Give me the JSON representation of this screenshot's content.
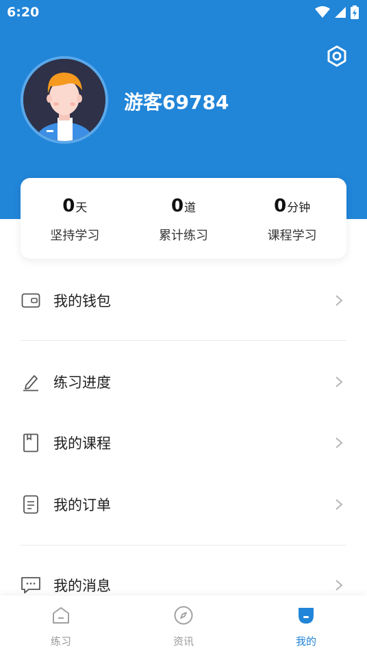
{
  "status_bar": {
    "time": "6:20",
    "icons": [
      "wifi-icon",
      "signal-icon",
      "battery-charging-icon"
    ]
  },
  "header": {
    "username": "游客69784",
    "settings_icon": "settings-hexagon-icon",
    "background_color": "#2185d8"
  },
  "stats": [
    {
      "value": "0",
      "unit": "天",
      "label": "坚持学习"
    },
    {
      "value": "0",
      "unit": "道",
      "label": "累计练习"
    },
    {
      "value": "0",
      "unit": "分钟",
      "label": "课程学习"
    }
  ],
  "menu": [
    {
      "label": "我的钱包",
      "icon": "wallet-icon"
    },
    {
      "label": "练习进度",
      "icon": "pencil-icon"
    },
    {
      "label": "我的课程",
      "icon": "book-icon"
    },
    {
      "label": "我的订单",
      "icon": "order-document-icon"
    },
    {
      "label": "我的消息",
      "icon": "message-bubble-icon"
    }
  ],
  "tabbar": {
    "active_color": "#2185d8",
    "inactive_color": "#9a9a9a",
    "tabs": [
      {
        "label": "练习",
        "icon": "practice-home-icon",
        "active": false
      },
      {
        "label": "资讯",
        "icon": "compass-icon",
        "active": false
      },
      {
        "label": "我的",
        "icon": "profile-icon",
        "active": true
      }
    ]
  }
}
